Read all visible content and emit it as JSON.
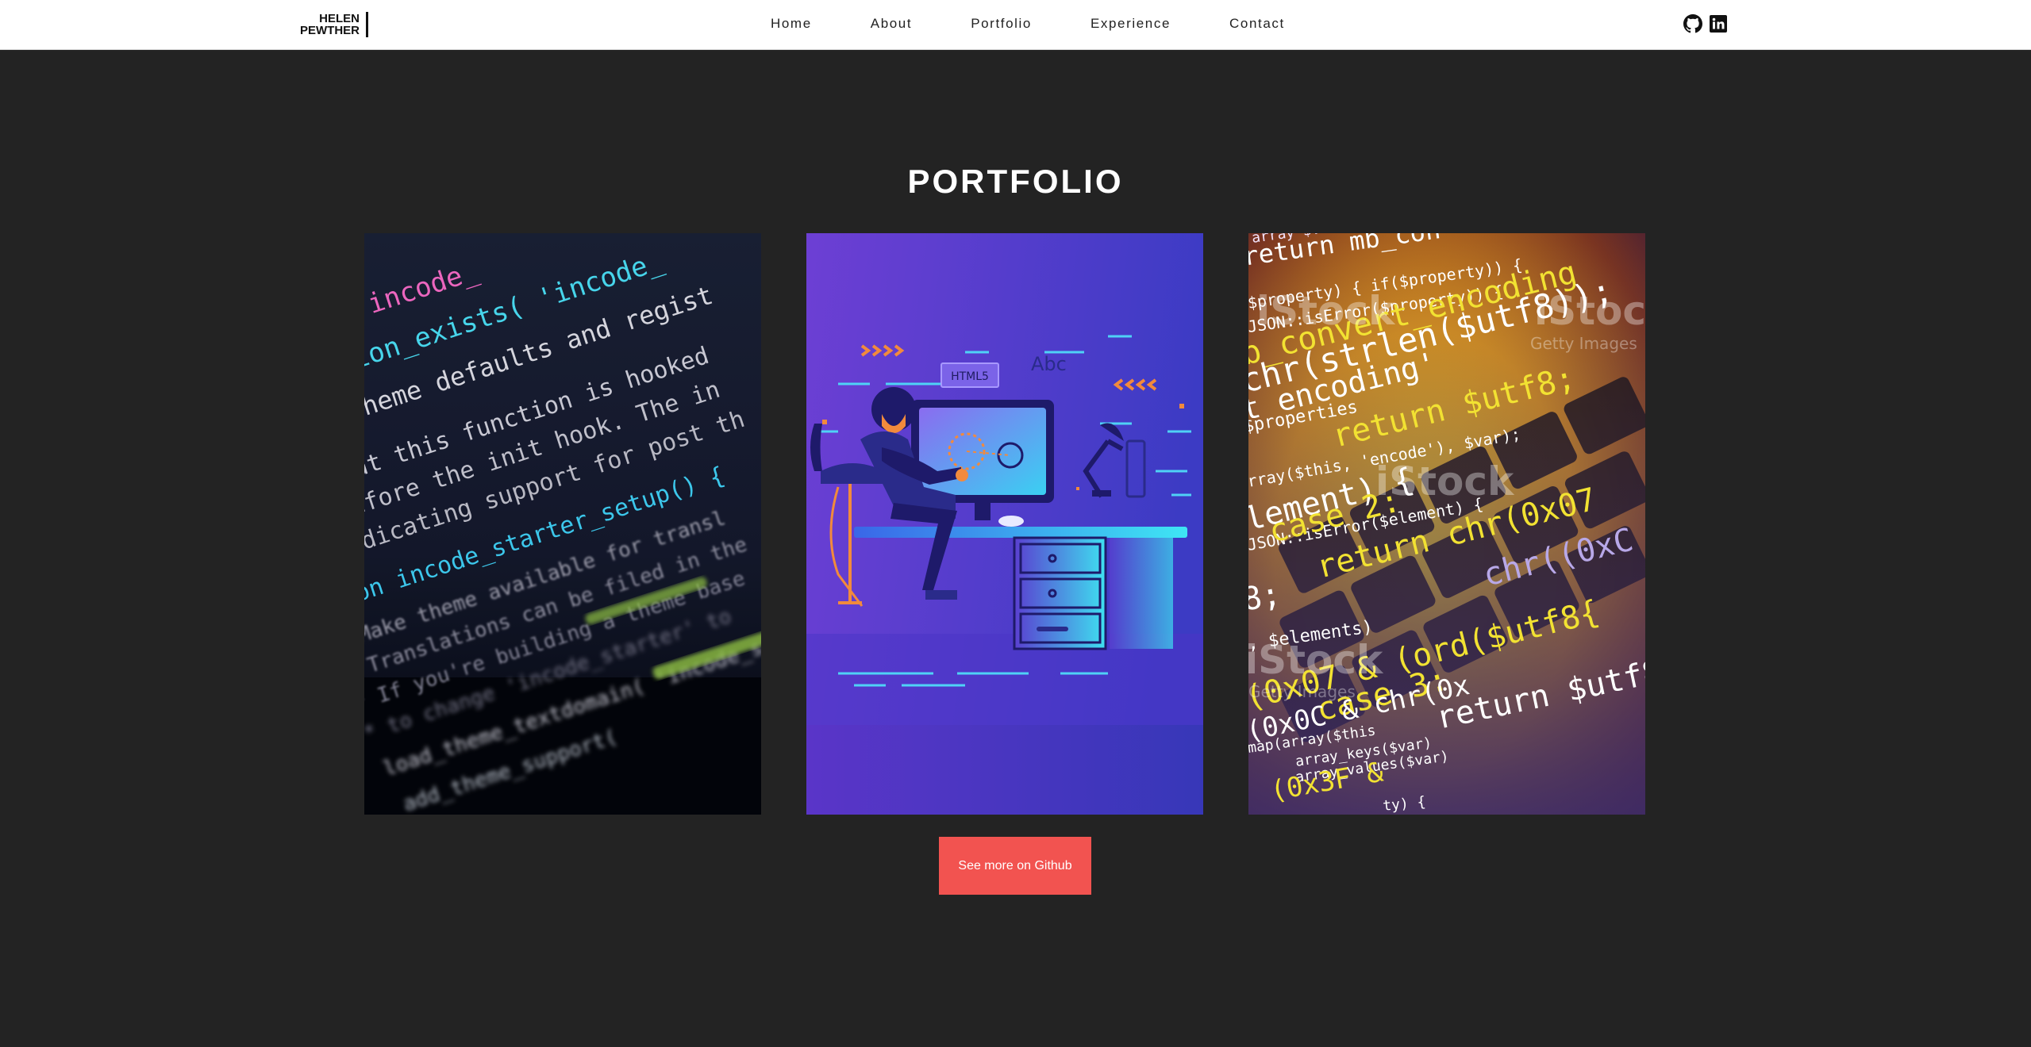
{
  "header": {
    "logo_line1": "HELEN",
    "logo_line2": "PEWTHER",
    "nav": [
      "Home",
      "About",
      "Portfolio",
      "Experience",
      "Contact"
    ]
  },
  "social": {
    "github_icon": "github-icon",
    "linkedin_icon": "linkedin-icon"
  },
  "portfolio": {
    "title": "PORTFOLIO",
    "button_label": "See more on Github",
    "card1": {
      "lines": [
        "ge = 'incode_",
        "function_exists( 'incode_",
        "s up theme defaults and regist",
        "te that this function is hooked",
        "ns before the init hook. The in",
        "s indicating support for post th",
        "ction incode_starter_setup() {",
        "* Make theme available for transl",
        "* Translations can be filed in the",
        "* If you're building a theme base",
        "* to change 'incode_starter' to",
        "load_theme_textdomain( 'incode_st",
        "add_theme_support("
      ]
    },
    "card2": {
      "tag_html": "HTML5",
      "tag_abc": "Abc"
    },
    "card3": {
      "lines": [
        "array $values",
        "return mb_con",
        "$property) { if($property)) {",
        "JSON::isError($property)) {",
        "b_convert_encoding",
        "chr(strlen($utf8));",
        "t encoding'",
        "$properties",
        "return $utf8;",
        "rray($this, 'encode'), $var);",
        "lement) {",
        "JSON::isError($element) {",
        "case 2:",
        "return chr(0x07",
        "chr((0xC",
        "8;",
        ", $elements)",
        "Stock",
        "(0x07 & (ord($utf8{",
        "case 3:",
        "(0x0C & chr(0x",
        "return $utf8",
        "map(array($this",
        "array_keys($var)",
        "array_values($var)",
        "(0x3F & ",
        "ty) {"
      ],
      "watermarks": [
        "iStock",
        "iStock",
        "Getty Images",
        "iStock",
        "iStock",
        "Getty Images"
      ]
    }
  }
}
